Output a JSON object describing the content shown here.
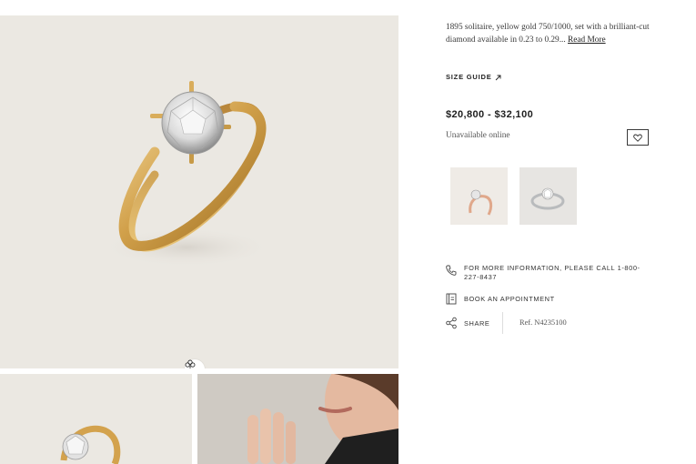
{
  "product": {
    "description_text": "1895 solitaire, yellow gold 750/1000, set with a brilliant-cut diamond available in 0.23 to 0.29...",
    "read_more_label": "Read More",
    "size_guide_label": "SIZE GUIDE",
    "size_guide_icon": "external-arrow-icon",
    "price": "$20,800 - $32,100",
    "availability": "Unavailable online",
    "wishlist_icon": "heart-icon",
    "variants": [
      {
        "name": "rose-gold-ring"
      },
      {
        "name": "platinum-ring"
      }
    ],
    "contact": {
      "phone_text": "FOR MORE INFORMATION, PLEASE CALL 1-800-227-8437",
      "phone_icon": "phone-icon",
      "appointment_label": "BOOK AN APPOINTMENT",
      "appointment_icon": "calendar-icon",
      "share_label": "SHARE",
      "share_icon": "share-icon",
      "reference": "Ref. N4235100"
    }
  },
  "gallery": {
    "main_image": "yellow-gold-solitaire-ring",
    "gesture_icon": "clover-icon",
    "thumbnails": [
      "ring-front-view",
      "model-hand-view"
    ]
  },
  "colors": {
    "image_background": "#ebe8e2",
    "gold": "#d4a64f",
    "text": "#2a2a2a"
  }
}
